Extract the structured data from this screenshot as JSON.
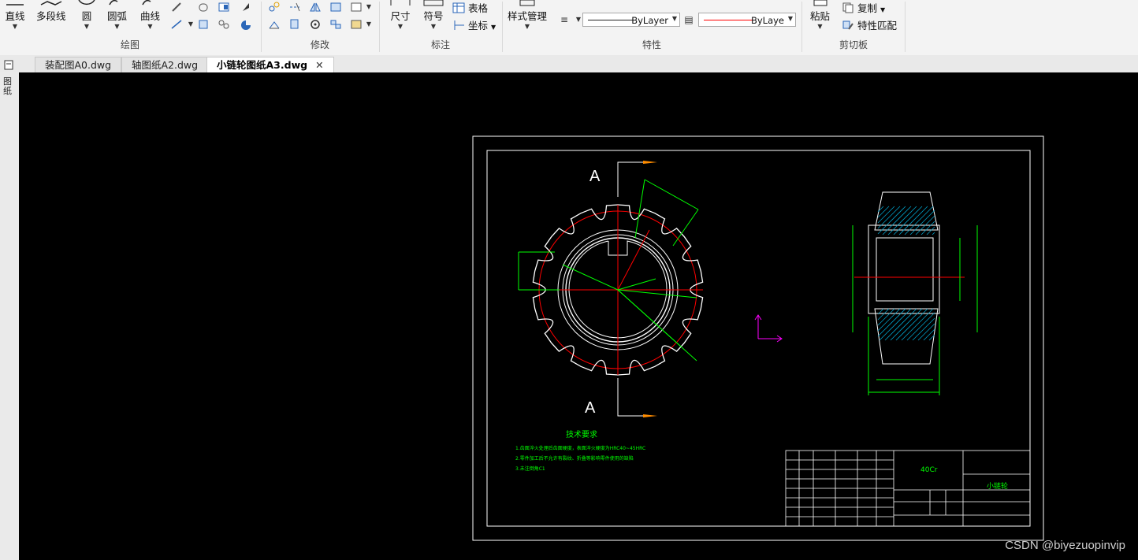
{
  "ribbon": {
    "draw": {
      "title": "绘图",
      "line": "直线",
      "polyline": "多段线",
      "circle": "圆",
      "arc": "圆弧",
      "curve": "曲线"
    },
    "modify": {
      "title": "修改"
    },
    "annotate": {
      "title": "标注",
      "dimension": "尺寸",
      "symbol": "符号",
      "table": "表格",
      "coordinate": "坐标"
    },
    "properties": {
      "title": "特性",
      "style_manager": "样式管理",
      "linetype": "ByLayer",
      "color": "ByLaye",
      "linetype_color": "#ffffff",
      "color_swatch": "#ff0000"
    },
    "clipboard": {
      "title": "剪切板",
      "paste": "粘贴",
      "copy": "复制",
      "match_properties": "特性匹配"
    }
  },
  "tabs": [
    {
      "label": "装配图A0.dwg",
      "active": false
    },
    {
      "label": "轴图纸A2.dwg",
      "active": false
    },
    {
      "label": "小链轮图纸A3.dwg",
      "active": true
    }
  ],
  "left_strip": {
    "label": "图纸"
  },
  "drawing": {
    "section_label_top": "A",
    "section_label_bottom": "A",
    "tech_req_title": "技术要求",
    "tech_req_lines": [
      "1.齿面淬火处理后齿面硬度，表面淬火硬度为HRC40~45HRC",
      "2.零件加工后不允许有裂纹、折叠等影响零件使用的缺陷",
      "3.未注倒角C1"
    ],
    "material": "40Cr",
    "part_name": "小链轮"
  },
  "watermark": "CSDN @biyezuopinvip",
  "colors": {
    "geometry": "#ffffff",
    "dimension": "#00ff00",
    "centerline": "#ff0000",
    "section_hatch": "#00a0c8",
    "ucs_icon": "#ff00ff",
    "marker": "#ff8c00"
  }
}
